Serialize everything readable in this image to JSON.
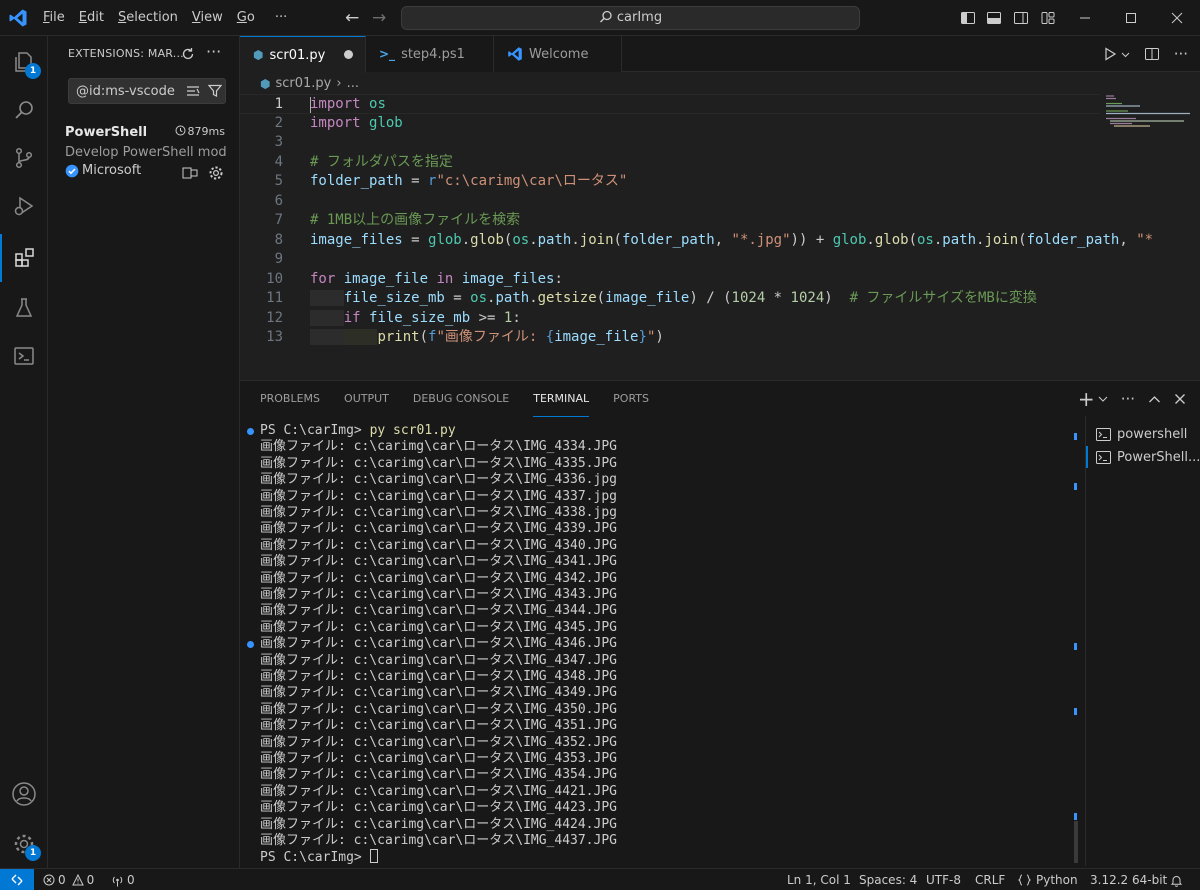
{
  "menu": [
    {
      "pre": "",
      "u": "F",
      "post": "ile"
    },
    {
      "pre": "",
      "u": "E",
      "post": "dit"
    },
    {
      "pre": "",
      "u": "S",
      "post": "election"
    },
    {
      "pre": "",
      "u": "V",
      "post": "iew"
    },
    {
      "pre": "",
      "u": "G",
      "post": "o"
    }
  ],
  "menu_more": "···",
  "search": {
    "text": "carImg"
  },
  "activity": {
    "explorer_badge": "1",
    "manage_badge": "1"
  },
  "sidebar": {
    "title": "EXTENSIONS: MAR...",
    "search_value": "@id:ms-vscode.p",
    "ext": {
      "name": "PowerShell",
      "time": "879ms",
      "desc": "Develop PowerShell mod...",
      "publisher": "Microsoft"
    }
  },
  "tabs": [
    {
      "label": "scr01.py",
      "icon": "python-icon"
    },
    {
      "label": "step4.ps1",
      "icon": "powershell-icon"
    },
    {
      "label": "Welcome",
      "icon": "vscode-icon"
    }
  ],
  "breadcrumb": {
    "file": "scr01.py",
    "sep": "›",
    "rest": "..."
  },
  "code_lines": [
    [
      {
        "c": "kw",
        "t": "import"
      },
      {
        "c": "",
        "t": " "
      },
      {
        "c": "mod",
        "t": "os"
      }
    ],
    [
      {
        "c": "kw",
        "t": "import"
      },
      {
        "c": "",
        "t": " "
      },
      {
        "c": "mod",
        "t": "glob"
      }
    ],
    [],
    [
      {
        "c": "com",
        "t": "# フォルダパスを指定"
      }
    ],
    [
      {
        "c": "var",
        "t": "folder_path"
      },
      {
        "c": "",
        "t": " = "
      },
      {
        "c": "ph",
        "t": "r"
      },
      {
        "c": "str",
        "t": "\"c:\\carimg\\car\\ロータス\""
      }
    ],
    [],
    [
      {
        "c": "com",
        "t": "# 1MB以上の画像ファイルを検索"
      }
    ],
    [
      {
        "c": "var",
        "t": "image_files"
      },
      {
        "c": "",
        "t": " = "
      },
      {
        "c": "mod",
        "t": "glob"
      },
      {
        "c": "",
        "t": "."
      },
      {
        "c": "fn",
        "t": "glob"
      },
      {
        "c": "",
        "t": "("
      },
      {
        "c": "mod",
        "t": "os"
      },
      {
        "c": "",
        "t": "."
      },
      {
        "c": "var",
        "t": "path"
      },
      {
        "c": "",
        "t": "."
      },
      {
        "c": "fn",
        "t": "join"
      },
      {
        "c": "",
        "t": "("
      },
      {
        "c": "var",
        "t": "folder_path"
      },
      {
        "c": "",
        "t": ", "
      },
      {
        "c": "str",
        "t": "\"*.jpg\""
      },
      {
        "c": "",
        "t": ")) + "
      },
      {
        "c": "mod",
        "t": "glob"
      },
      {
        "c": "",
        "t": "."
      },
      {
        "c": "fn",
        "t": "glob"
      },
      {
        "c": "",
        "t": "("
      },
      {
        "c": "mod",
        "t": "os"
      },
      {
        "c": "",
        "t": "."
      },
      {
        "c": "var",
        "t": "path"
      },
      {
        "c": "",
        "t": "."
      },
      {
        "c": "fn",
        "t": "join"
      },
      {
        "c": "",
        "t": "("
      },
      {
        "c": "var",
        "t": "folder_path"
      },
      {
        "c": "",
        "t": ", "
      },
      {
        "c": "str",
        "t": "\"*"
      }
    ],
    [],
    [
      {
        "c": "kw",
        "t": "for"
      },
      {
        "c": "",
        "t": " "
      },
      {
        "c": "var",
        "t": "image_file"
      },
      {
        "c": "",
        "t": " "
      },
      {
        "c": "kw",
        "t": "in"
      },
      {
        "c": "",
        "t": " "
      },
      {
        "c": "var",
        "t": "image_files"
      },
      {
        "c": "",
        "t": ":"
      }
    ],
    [
      {
        "c": "ind1",
        "t": "    "
      },
      {
        "c": "var",
        "t": "file_size_mb"
      },
      {
        "c": "",
        "t": " = "
      },
      {
        "c": "mod",
        "t": "os"
      },
      {
        "c": "",
        "t": "."
      },
      {
        "c": "var",
        "t": "path"
      },
      {
        "c": "",
        "t": "."
      },
      {
        "c": "fn",
        "t": "getsize"
      },
      {
        "c": "",
        "t": "("
      },
      {
        "c": "var",
        "t": "image_file"
      },
      {
        "c": "",
        "t": ") / ("
      },
      {
        "c": "num",
        "t": "1024"
      },
      {
        "c": "",
        "t": " * "
      },
      {
        "c": "num",
        "t": "1024"
      },
      {
        "c": "",
        "t": ")  "
      },
      {
        "c": "com",
        "t": "# ファイルサイズをMBに変換"
      }
    ],
    [
      {
        "c": "ind1",
        "t": "    "
      },
      {
        "c": "kw",
        "t": "if"
      },
      {
        "c": "",
        "t": " "
      },
      {
        "c": "var",
        "t": "file_size_mb"
      },
      {
        "c": "",
        "t": " >= "
      },
      {
        "c": "num",
        "t": "1"
      },
      {
        "c": "",
        "t": ":"
      }
    ],
    [
      {
        "c": "ind1",
        "t": "    "
      },
      {
        "c": "ind2",
        "t": "    "
      },
      {
        "c": "fn",
        "t": "print"
      },
      {
        "c": "",
        "t": "("
      },
      {
        "c": "ph",
        "t": "f"
      },
      {
        "c": "str",
        "t": "\"画像ファイル: "
      },
      {
        "c": "ph",
        "t": "{"
      },
      {
        "c": "var",
        "t": "image_file"
      },
      {
        "c": "ph",
        "t": "}"
      },
      {
        "c": "str",
        "t": "\""
      },
      {
        "c": "",
        "t": ")"
      }
    ]
  ],
  "panel_tabs": [
    "PROBLEMS",
    "OUTPUT",
    "DEBUG CONSOLE",
    "TERMINAL",
    "PORTS"
  ],
  "terminal": {
    "prompt": "PS C:\\carImg> ",
    "command": "py scr01.py",
    "output_prefix": "画像ファイル: c:\\carimg\\car\\ロータス\\",
    "files": [
      "IMG_4334.JPG",
      "IMG_4335.JPG",
      "IMG_4336.jpg",
      "IMG_4337.jpg",
      "IMG_4338.jpg",
      "IMG_4339.JPG",
      "IMG_4340.JPG",
      "IMG_4341.JPG",
      "IMG_4342.JPG",
      "IMG_4343.JPG",
      "IMG_4344.JPG",
      "IMG_4345.JPG",
      "IMG_4346.JPG",
      "IMG_4347.JPG",
      "IMG_4348.JPG",
      "IMG_4349.JPG",
      "IMG_4350.JPG",
      "IMG_4351.JPG",
      "IMG_4352.JPG",
      "IMG_4353.JPG",
      "IMG_4354.JPG",
      "IMG_4421.JPG",
      "IMG_4423.JPG",
      "IMG_4424.JPG",
      "IMG_4437.JPG"
    ],
    "final_prompt": "PS C:\\carImg> "
  },
  "terminal_list": [
    "powershell",
    "PowerShell..."
  ],
  "status": {
    "errors": "0",
    "warnings": "0",
    "ports": "0",
    "position": "Ln 1, Col 1",
    "spaces": "Spaces: 4",
    "encoding": "UTF-8",
    "eol": "CRLF",
    "language": "Python",
    "interpreter": "3.12.2 64-bit"
  },
  "colors": {
    "accent": "#0078d4",
    "background": "#1f1f1f",
    "chrome": "#181818"
  }
}
